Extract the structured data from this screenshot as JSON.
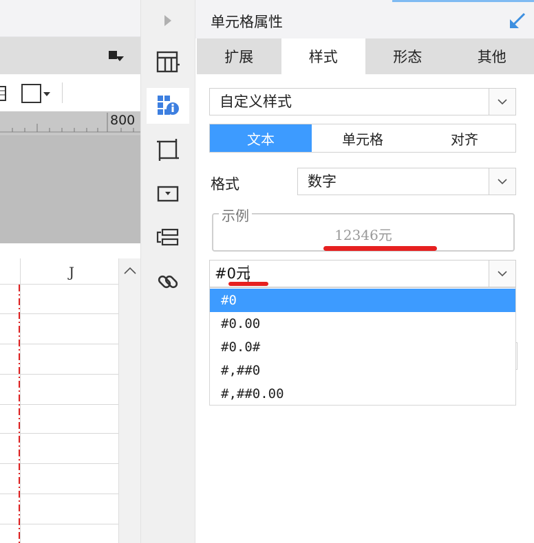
{
  "designer": {
    "ruler_label": "800",
    "column_label": "J"
  },
  "panel": {
    "title": "单元格属性",
    "tabs": [
      {
        "label": "扩展"
      },
      {
        "label": "样式"
      },
      {
        "label": "形态"
      },
      {
        "label": "其他"
      }
    ],
    "style_select": "自定义样式",
    "subtabs": [
      {
        "label": "文本"
      },
      {
        "label": "单元格"
      },
      {
        "label": "对齐"
      }
    ],
    "format_label": "格式",
    "format_select": "数字",
    "example_legend": "示例",
    "example_value": "12346元",
    "pattern_input": "#0元",
    "pattern_options": [
      "#0",
      "#0.00",
      "#0.0#",
      "#,##0",
      "#,##0.00"
    ]
  },
  "colors": {
    "accent": "#3d9bff",
    "annotation_red": "#e62020"
  }
}
